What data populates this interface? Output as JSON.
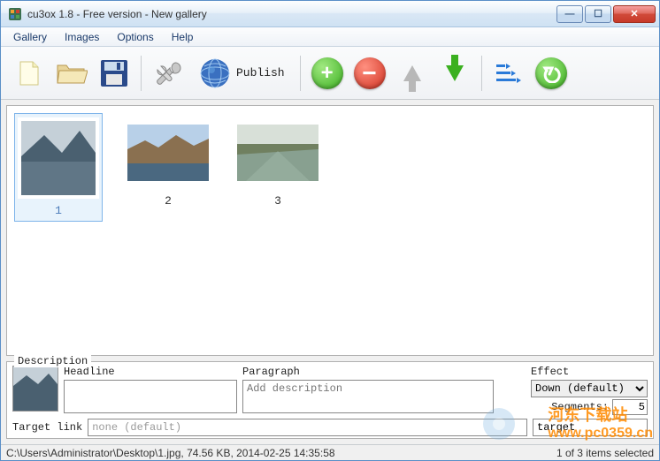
{
  "title": "cu3ox 1.8 - Free version - New gallery",
  "menu": {
    "gallery": "Gallery",
    "images": "Images",
    "options": "Options",
    "help": "Help"
  },
  "toolbar": {
    "publish": "Publish"
  },
  "thumbs": [
    {
      "label": "1",
      "selected": true
    },
    {
      "label": "2",
      "selected": false
    },
    {
      "label": "3",
      "selected": false
    }
  ],
  "details": {
    "panel_label": "Description",
    "headline_label": "Headline",
    "headline_value": "",
    "paragraph_label": "Paragraph",
    "paragraph_placeholder": "Add description",
    "effect_label": "Effect",
    "effect_value": "Down (default)",
    "segments_label": "Segments:",
    "segments_value": "5",
    "target_link_label": "Target link",
    "target_link_value": "none (default)",
    "target_label": "target"
  },
  "status": {
    "left": "C:\\Users\\Administrator\\Desktop\\1.jpg, 74.56 KB, 2014-02-25 14:35:58",
    "right": "1 of 3 items selected"
  },
  "watermark": {
    "cn": "河东下载站",
    "url": "www.pc0359.cn"
  }
}
